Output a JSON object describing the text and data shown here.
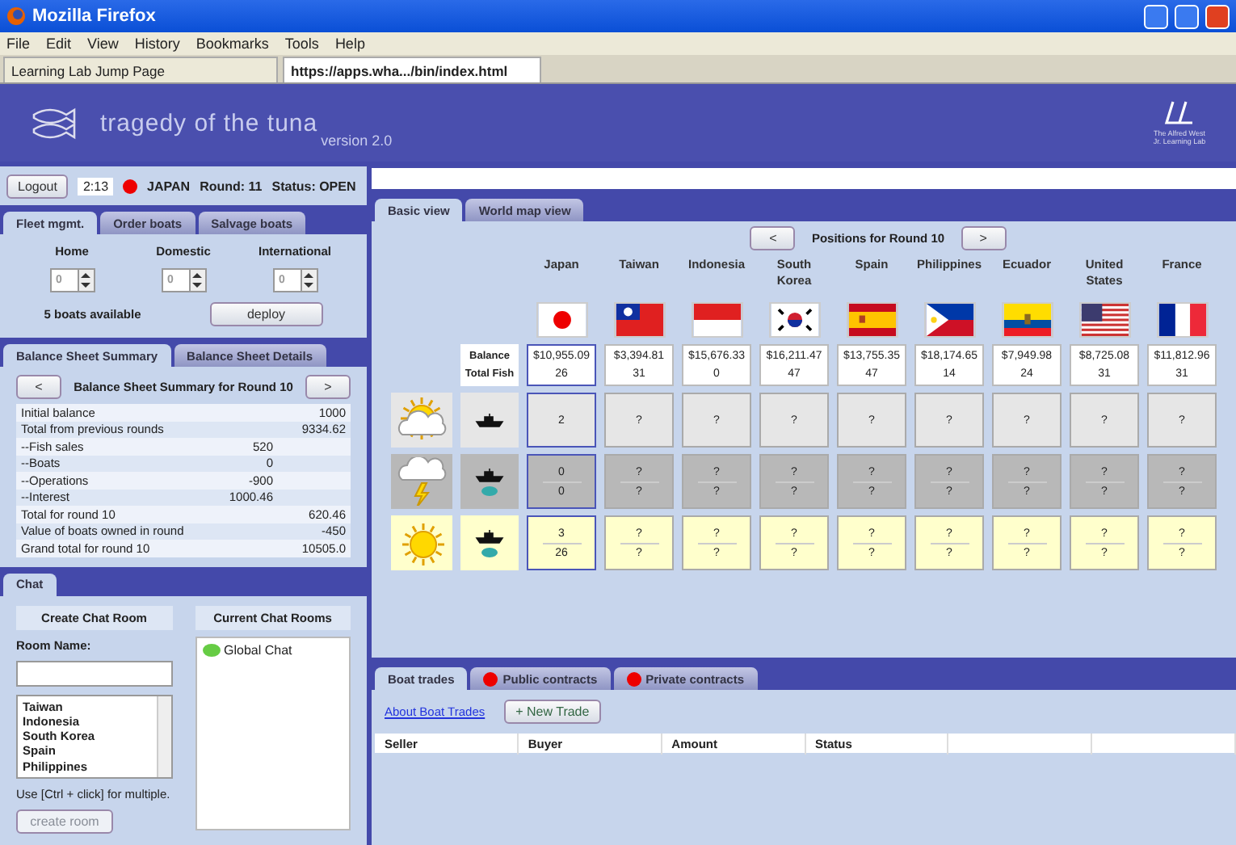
{
  "browser": {
    "title": "Mozilla Firefox",
    "menu": [
      "File",
      "Edit",
      "View",
      "History",
      "Bookmarks",
      "Tools",
      "Help"
    ],
    "tabs": [
      {
        "label": "Learning Lab Jump Page",
        "selected": false
      },
      {
        "label": "https://apps.wha.../bin/index.html",
        "selected": true
      }
    ]
  },
  "header": {
    "title": "tragedy of the tuna",
    "version": "version 2.0",
    "lab": "The Alfred West Jr. Learning Lab"
  },
  "status": {
    "logout": "Logout",
    "time": "2:13",
    "country": "JAPAN",
    "round": "Round: 11",
    "state": "Status: OPEN"
  },
  "fleet": {
    "tabs": [
      {
        "label": "Fleet mgmt.",
        "selected": true
      },
      {
        "label": "Order boats",
        "selected": false
      },
      {
        "label": "Salvage boats",
        "selected": false
      }
    ],
    "fields": [
      {
        "label": "Home",
        "value": "0"
      },
      {
        "label": "Domestic",
        "value": "0"
      },
      {
        "label": "International",
        "value": "0"
      }
    ],
    "available": "5 boats available",
    "deploy": "deploy"
  },
  "balance": {
    "tabs": [
      {
        "label": "Balance Sheet Summary",
        "selected": true
      },
      {
        "label": "Balance Sheet Details",
        "selected": false
      }
    ],
    "prev": "<",
    "next": ">",
    "title": "Balance Sheet Summary for Round 10",
    "rows": [
      {
        "label": "Initial balance",
        "value": "1000",
        "kind": "main"
      },
      {
        "label": "Total from previous rounds",
        "value": "9334.62",
        "kind": "main"
      },
      {
        "label": "--Fish sales",
        "value": "520",
        "kind": "sub"
      },
      {
        "label": "--Boats",
        "value": "0",
        "kind": "sub"
      },
      {
        "label": "--Operations",
        "value": "-900",
        "kind": "sub"
      },
      {
        "label": "--Interest",
        "value": "1000.46",
        "kind": "sub"
      },
      {
        "label": "Total for round 10",
        "value": "620.46",
        "kind": "main"
      },
      {
        "label": "Value of boats owned in round",
        "value": "-450",
        "kind": "main"
      },
      {
        "label": "Grand total for round 10",
        "value": "10505.0",
        "kind": "main"
      }
    ]
  },
  "chat": {
    "tab": "Chat",
    "create_heading": "Create Chat Room",
    "current_heading": "Current Chat Rooms",
    "room_label": "Room Name:",
    "countries": [
      "Taiwan",
      "Indonesia",
      "South Korea",
      "Spain",
      "Philippines"
    ],
    "hint": "Use [Ctrl + click] for multiple.",
    "create_button": {
      "label": "create room",
      "disabled": true
    },
    "rooms": [
      "Global Chat"
    ]
  },
  "view_tabs": [
    {
      "label": "Basic view",
      "selected": true
    },
    {
      "label": "World map view",
      "selected": false
    }
  ],
  "positions": {
    "prev": "<",
    "next": ">",
    "title": "Positions for Round 10",
    "summary_label": [
      "Balance",
      "Total Fish"
    ],
    "countries": [
      {
        "name": "Japan",
        "kind": "jp",
        "balance": "$10,955.09",
        "fish": "26",
        "selected": true
      },
      {
        "name": "Taiwan",
        "kind": "tw",
        "balance": "$3,394.81",
        "fish": "31",
        "selected": false
      },
      {
        "name": "Indonesia",
        "kind": "id",
        "balance": "$15,676.33",
        "fish": "0",
        "selected": false
      },
      {
        "name": "South Korea",
        "kind": "kr",
        "balance": "$16,211.47",
        "fish": "47",
        "selected": false
      },
      {
        "name": "Spain",
        "kind": "es",
        "balance": "$13,755.35",
        "fish": "47",
        "selected": false
      },
      {
        "name": "Philippines",
        "kind": "ph",
        "balance": "$18,174.65",
        "fish": "14",
        "selected": false
      },
      {
        "name": "Ecuador",
        "kind": "ec",
        "balance": "$7,949.98",
        "fish": "24",
        "selected": false
      },
      {
        "name": "United States",
        "kind": "us",
        "balance": "$8,725.08",
        "fish": "31",
        "selected": false
      },
      {
        "name": "France",
        "kind": "fr",
        "balance": "$11,812.96",
        "fish": "31",
        "selected": false
      }
    ],
    "zones": [
      {
        "kind": "cloudy",
        "cells": [
          [
            "2"
          ],
          [
            "?"
          ],
          [
            "?"
          ],
          [
            "?"
          ],
          [
            "?"
          ],
          [
            "?"
          ],
          [
            "?"
          ],
          [
            "?"
          ],
          [
            "?"
          ]
        ]
      },
      {
        "kind": "storm",
        "cells": [
          [
            "0",
            "0"
          ],
          [
            "?",
            "?"
          ],
          [
            "?",
            "?"
          ],
          [
            "?",
            "?"
          ],
          [
            "?",
            "?"
          ],
          [
            "?",
            "?"
          ],
          [
            "?",
            "?"
          ],
          [
            "?",
            "?"
          ],
          [
            "?",
            "?"
          ]
        ]
      },
      {
        "kind": "sunny",
        "cells": [
          [
            "3",
            "26"
          ],
          [
            "?",
            "?"
          ],
          [
            "?",
            "?"
          ],
          [
            "?",
            "?"
          ],
          [
            "?",
            "?"
          ],
          [
            "?",
            "?"
          ],
          [
            "?",
            "?"
          ],
          [
            "?",
            "?"
          ],
          [
            "?",
            "?"
          ]
        ]
      }
    ]
  },
  "trades": {
    "tabs": [
      {
        "label": "Boat trades",
        "selected": true,
        "alert": false
      },
      {
        "label": "Public contracts",
        "selected": false,
        "alert": true
      },
      {
        "label": "Private contracts",
        "selected": false,
        "alert": true
      }
    ],
    "link": "About Boat Trades",
    "new_trade": "+ New Trade",
    "columns": [
      "Seller",
      "Buyer",
      "Amount",
      "Status"
    ]
  }
}
